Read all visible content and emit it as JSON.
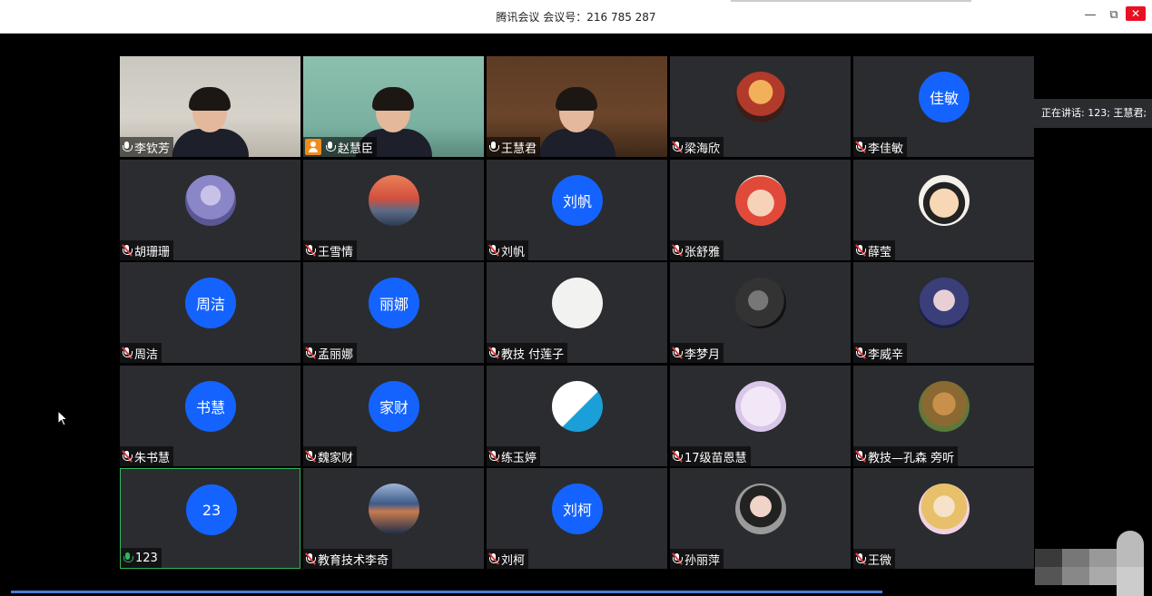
{
  "window": {
    "title": "腾讯会议 会议号：216 785 287",
    "minimize": "—",
    "restore": "⧉",
    "close": "✕"
  },
  "speaking_now": "正在讲话: 123; 王慧君;",
  "colors": {
    "avatar_blue": "#1463ff",
    "tile_bg": "#2b2c30",
    "active_border": "#2eb85c",
    "muted_red": "#e03c3c",
    "host_orange": "#f08c1a"
  },
  "participants": [
    {
      "name": "李钦芳",
      "mic": "on",
      "avatar_text": "",
      "video": true
    },
    {
      "name": "赵慧臣",
      "mic": "on",
      "avatar_text": "",
      "video": true,
      "host": true
    },
    {
      "name": "王慧君",
      "mic": "on",
      "avatar_text": "",
      "video": true
    },
    {
      "name": "梁海欣",
      "mic": "muted",
      "avatar_text": "",
      "avatar_icon": "anime-avatar"
    },
    {
      "name": "李佳敏",
      "mic": "muted",
      "avatar_text": "佳敏"
    },
    {
      "name": "胡珊珊",
      "mic": "muted",
      "avatar_text": "",
      "avatar_icon": "photo-avatar"
    },
    {
      "name": "王雪情",
      "mic": "muted",
      "avatar_text": "",
      "avatar_icon": "sunset-avatar"
    },
    {
      "name": "刘帆",
      "mic": "muted",
      "avatar_text": "刘帆"
    },
    {
      "name": "张舒雅",
      "mic": "muted",
      "avatar_text": "",
      "avatar_icon": "cartoon-avatar"
    },
    {
      "name": "薛莹",
      "mic": "muted",
      "avatar_text": "",
      "avatar_icon": "crayon-shin-avatar"
    },
    {
      "name": "周洁",
      "mic": "muted",
      "avatar_text": "周洁"
    },
    {
      "name": "孟丽娜",
      "mic": "muted",
      "avatar_text": "丽娜"
    },
    {
      "name": "教技 付莲子",
      "mic": "muted",
      "avatar_text": "",
      "avatar_icon": "calligraphy-avatar"
    },
    {
      "name": "李梦月",
      "mic": "muted",
      "avatar_text": "",
      "avatar_icon": "bw-photo-avatar"
    },
    {
      "name": "李威辛",
      "mic": "muted",
      "avatar_text": "",
      "avatar_icon": "anime-boy-avatar"
    },
    {
      "name": "朱书慧",
      "mic": "muted",
      "avatar_text": "书慧"
    },
    {
      "name": "魏家财",
      "mic": "muted",
      "avatar_text": "家财"
    },
    {
      "name": "练玉婷",
      "mic": "muted",
      "avatar_text": "",
      "avatar_icon": "bear-avatar"
    },
    {
      "name": "17级苗恩慧",
      "mic": "muted",
      "avatar_text": "",
      "avatar_icon": "cat-avatar"
    },
    {
      "name": "教技—孔森  旁听",
      "mic": "muted",
      "avatar_text": "",
      "avatar_icon": "lion-avatar"
    },
    {
      "name": "123",
      "mic": "active",
      "avatar_text": "23",
      "active": true
    },
    {
      "name": "教育技术李奇",
      "mic": "muted",
      "avatar_text": "",
      "avatar_icon": "sea-avatar"
    },
    {
      "name": "刘柯",
      "mic": "muted",
      "avatar_text": "刘柯"
    },
    {
      "name": "孙丽萍",
      "mic": "muted",
      "avatar_text": "",
      "avatar_icon": "selfie-avatar"
    },
    {
      "name": "王微",
      "mic": "muted",
      "avatar_text": "",
      "avatar_icon": "princess-avatar"
    }
  ]
}
